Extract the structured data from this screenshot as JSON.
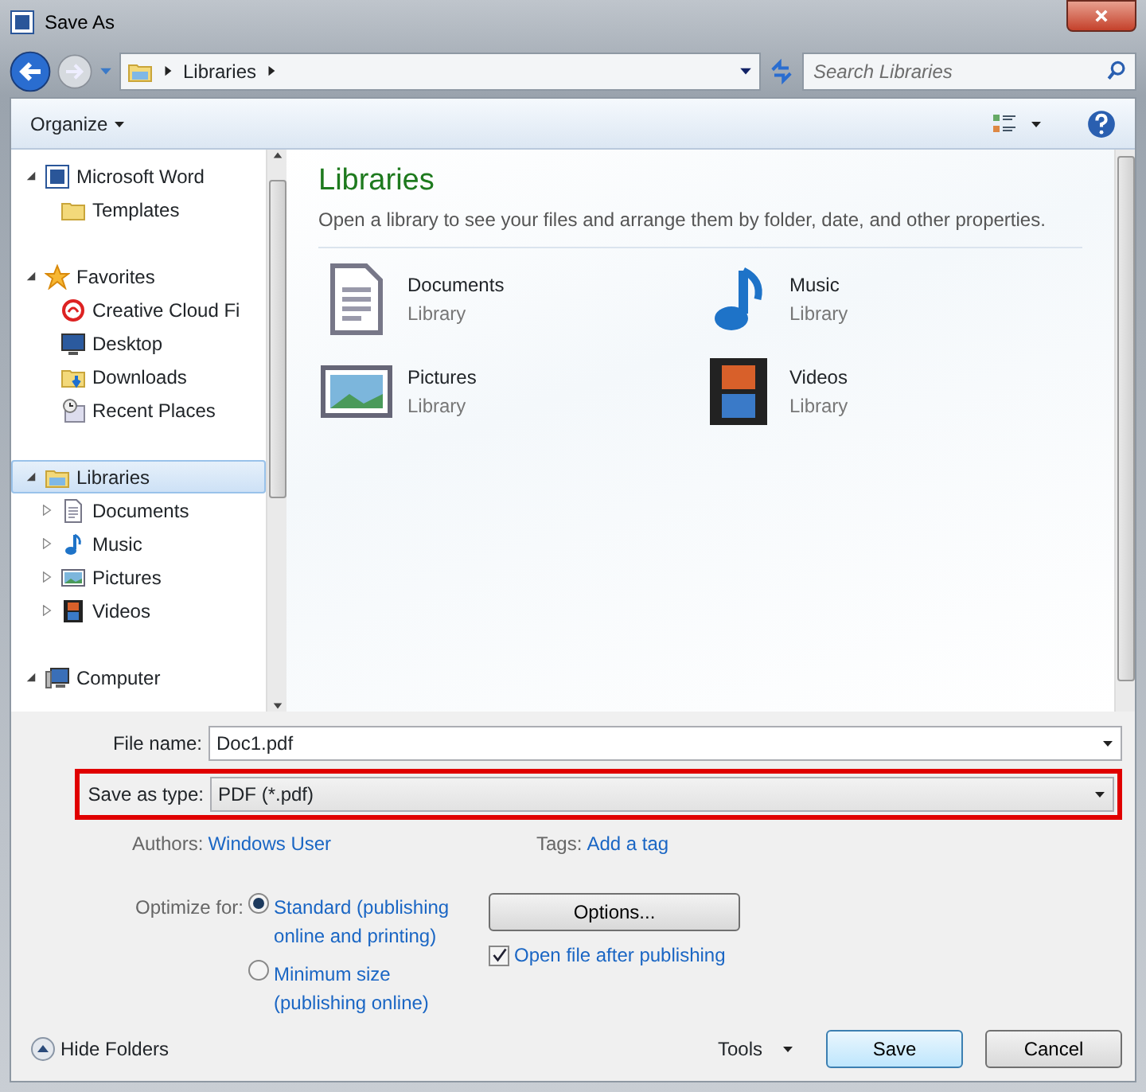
{
  "window": {
    "title": "Save As"
  },
  "nav": {
    "path": [
      "Libraries"
    ],
    "search_placeholder": "Search Libraries"
  },
  "toolbar": {
    "organize": "Organize"
  },
  "sidebar": [
    {
      "label": "Microsoft Word",
      "kind": "word",
      "expandable": true,
      "expanded": true,
      "selected": false,
      "children": [
        {
          "label": "Templates",
          "kind": "folder",
          "expandable": false,
          "selected": false
        }
      ]
    },
    {
      "label": "Favorites",
      "kind": "star",
      "expandable": true,
      "expanded": true,
      "selected": false,
      "children": [
        {
          "label": "Creative Cloud Fi",
          "kind": "cloud",
          "expandable": false,
          "selected": false
        },
        {
          "label": "Desktop",
          "kind": "desktop",
          "expandable": false,
          "selected": false
        },
        {
          "label": "Downloads",
          "kind": "downloads",
          "expandable": false,
          "selected": false
        },
        {
          "label": "Recent Places",
          "kind": "recent",
          "expandable": false,
          "selected": false
        }
      ]
    },
    {
      "label": "Libraries",
      "kind": "library",
      "expandable": true,
      "expanded": true,
      "selected": true,
      "children": [
        {
          "label": "Documents",
          "kind": "documents",
          "expandable": true,
          "expanded": false,
          "selected": false
        },
        {
          "label": "Music",
          "kind": "music",
          "expandable": true,
          "expanded": false,
          "selected": false
        },
        {
          "label": "Pictures",
          "kind": "pictures",
          "expandable": true,
          "expanded": false,
          "selected": false
        },
        {
          "label": "Videos",
          "kind": "videos",
          "expandable": true,
          "expanded": false,
          "selected": false
        }
      ]
    },
    {
      "label": "Computer",
      "kind": "computer",
      "expandable": true,
      "expanded": true,
      "selected": false
    }
  ],
  "content": {
    "title": "Libraries",
    "description": "Open a library to see your files and arrange them by folder, date, and other properties.",
    "items": [
      {
        "name": "Documents",
        "subtitle": "Library",
        "kind": "documents"
      },
      {
        "name": "Music",
        "subtitle": "Library",
        "kind": "music"
      },
      {
        "name": "Pictures",
        "subtitle": "Library",
        "kind": "pictures"
      },
      {
        "name": "Videos",
        "subtitle": "Library",
        "kind": "videos"
      }
    ]
  },
  "form": {
    "file_name": {
      "label": "File name:",
      "value": "Doc1.pdf"
    },
    "save_type": {
      "label": "Save as type:",
      "value": "PDF (*.pdf)",
      "highlighted": true
    },
    "authors": {
      "label": "Authors:",
      "value": "Windows User"
    },
    "tags": {
      "label": "Tags:",
      "value": "Add a tag"
    },
    "optimize": {
      "label": "Optimize for:",
      "options": [
        {
          "label": "Standard (publishing online and printing)",
          "selected": true
        },
        {
          "label": "Minimum size (publishing online)",
          "selected": false
        }
      ]
    },
    "options_button": "Options...",
    "open_after": {
      "label": "Open file after publishing",
      "checked": true
    }
  },
  "footer": {
    "hide_folders": "Hide Folders",
    "tools": "Tools",
    "save": "Save",
    "cancel": "Cancel"
  }
}
